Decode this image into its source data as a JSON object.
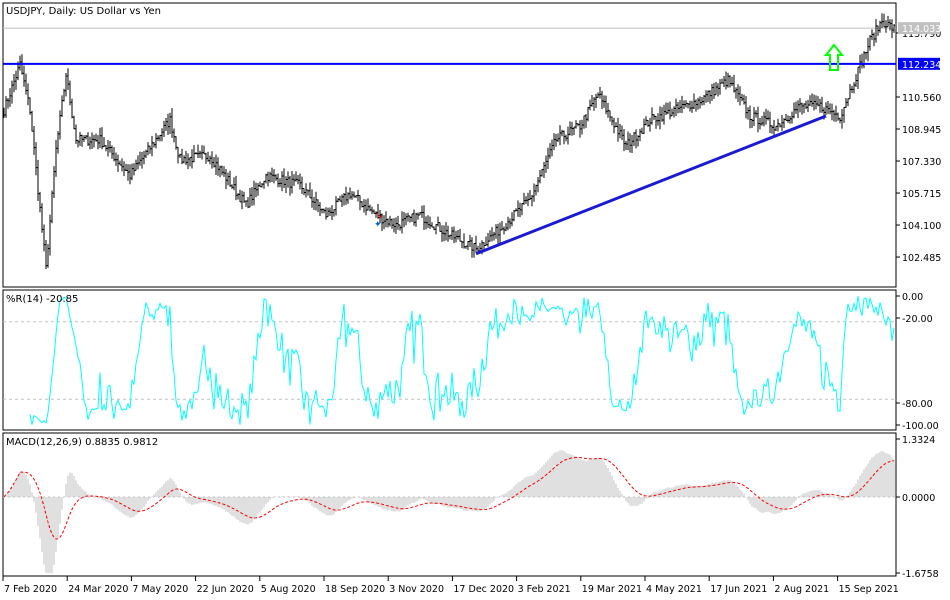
{
  "window": {
    "title": "USDJPY, Daily:  US Dollar vs Yen"
  },
  "price_panel": {
    "axis_ticks": [
      "113.790",
      "110.560",
      "108.945",
      "107.330",
      "105.715",
      "104.100",
      "102.485"
    ],
    "axis_tick_values": [
      113.79,
      110.56,
      108.945,
      107.33,
      105.715,
      104.1,
      102.485
    ],
    "current_price_label": "114.033",
    "current_price": 114.033,
    "hline_label": "112.234",
    "hline_price": 112.234,
    "colors": {
      "hline": "#0000ff",
      "trendline": "#1a1ad6",
      "arrow": "#00ff00",
      "bars": "#000000",
      "current": "#c0c0c0"
    },
    "trendline": {
      "from_bar": 236,
      "from_price": 102.65,
      "to_bar": 411,
      "to_price": 109.6
    },
    "arrow_bar": 415
  },
  "wpr_panel": {
    "label": "%R(14) -20.85",
    "axis_ticks": [
      "0.00",
      "-20.00",
      "-80.00",
      "-100.00"
    ],
    "color": "#00ffff"
  },
  "macd_panel": {
    "label": "MACD(12,26,9) 0.8835 0.9812",
    "axis_ticks": [
      "1.3324",
      "0.0000",
      "-1.6758"
    ],
    "range": [
      -1.6758,
      1.3324
    ],
    "colors": {
      "histogram": "#c0c0c0",
      "signal": "#ff0000"
    }
  },
  "time_axis": {
    "labels": [
      "7 Feb 2020",
      "24 Mar 2020",
      "7 May 2020",
      "22 Jun 2020",
      "5 Aug 2020",
      "18 Sep 2020",
      "3 Nov 2020",
      "17 Dec 2020",
      "3 Feb 2021",
      "19 Mar 2021",
      "4 May 2021",
      "17 Jun 2021",
      "2 Aug 2021",
      "15 Sep 2021"
    ]
  },
  "chart_data": {
    "type": "ohlc",
    "symbol": "USDJPY",
    "timeframe": "Daily",
    "keypoints_bar_price": [
      [
        0,
        109.9
      ],
      [
        8,
        112.2
      ],
      [
        13,
        109.9
      ],
      [
        21,
        101.9
      ],
      [
        26,
        107.9
      ],
      [
        31,
        111.7
      ],
      [
        36,
        108.4
      ],
      [
        48,
        108.4
      ],
      [
        63,
        106.6
      ],
      [
        83,
        109.4
      ],
      [
        88,
        107.4
      ],
      [
        103,
        107.6
      ],
      [
        121,
        105.1
      ],
      [
        131,
        106.6
      ],
      [
        148,
        106.1
      ],
      [
        161,
        104.6
      ],
      [
        173,
        105.7
      ],
      [
        186,
        104.6
      ],
      [
        196,
        104.1
      ],
      [
        208,
        104.6
      ],
      [
        223,
        103.6
      ],
      [
        236,
        102.9
      ],
      [
        248,
        103.9
      ],
      [
        263,
        105.4
      ],
      [
        276,
        108.4
      ],
      [
        288,
        109.1
      ],
      [
        297,
        110.7
      ],
      [
        311,
        108.1
      ],
      [
        323,
        109.4
      ],
      [
        348,
        110.4
      ],
      [
        362,
        111.4
      ],
      [
        373,
        109.6
      ],
      [
        386,
        109.1
      ],
      [
        398,
        110.1
      ],
      [
        408,
        110.1
      ],
      [
        418,
        109.6
      ],
      [
        427,
        111.9
      ],
      [
        433,
        113.4
      ],
      [
        439,
        114.4
      ],
      [
        445,
        114.0
      ]
    ]
  }
}
